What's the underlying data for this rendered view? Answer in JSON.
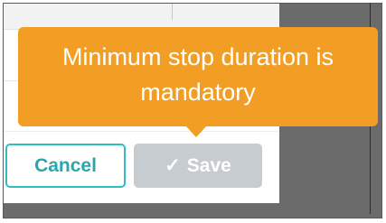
{
  "tooltip": {
    "line1": "Minimum stop duration is",
    "line2": "mandatory"
  },
  "buttons": {
    "cancel_label": "Cancel",
    "save_label": "Save",
    "save_icon": "check-icon",
    "save_state": "disabled"
  },
  "colors": {
    "tooltip_bg": "#f29e24",
    "cancel_accent": "#2fbcc2",
    "save_disabled_bg": "#c6ccd0",
    "overlay": "#6b6b6b"
  }
}
